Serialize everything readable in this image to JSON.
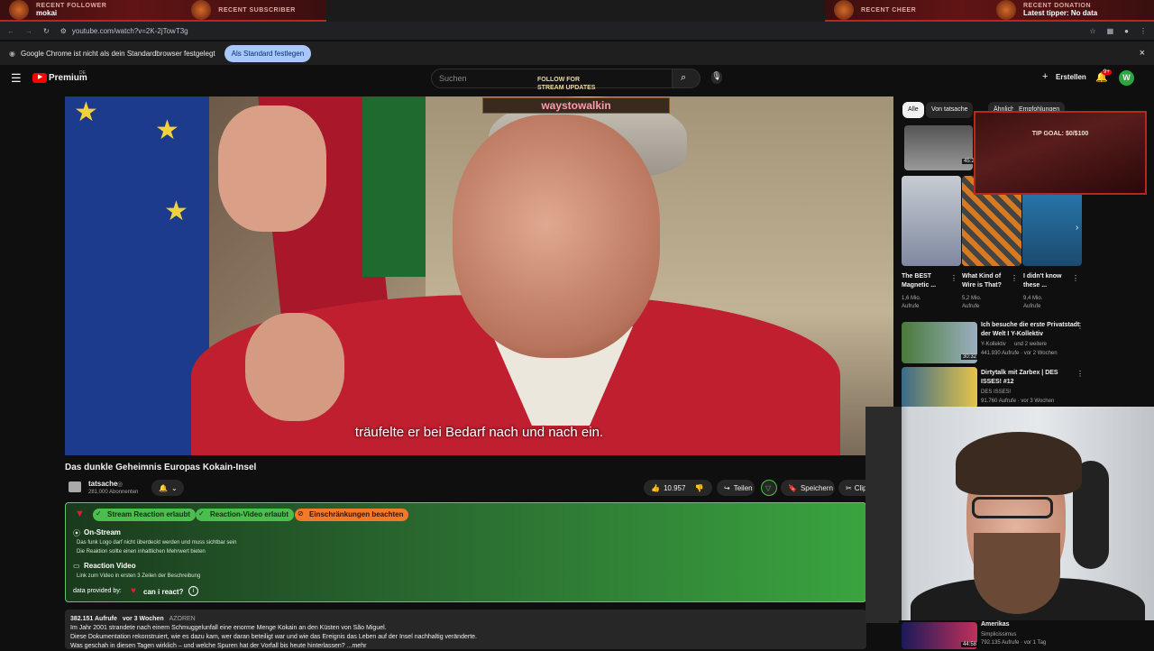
{
  "overlay": {
    "recent_follower_label": "RECENT FOLLOWER",
    "recent_follower_value": "mokai",
    "recent_subscriber_label": "RECENT SUBSCRIBER",
    "recent_subscriber_value": "",
    "recent_cheer_label": "RECENT CHEER",
    "recent_cheer_value": "",
    "recent_donation_label": "RECENT DONATION",
    "recent_donation_value": "Latest tipper: No data",
    "follow_text_1": "FOLLOW FOR",
    "follow_text_2": "STREAM UPDATES",
    "streamer_name": "waystowalkin",
    "tip_goal": "TIP GOAL: $0/$100"
  },
  "browser": {
    "url": "youtube.com/watch?v=2K-2jTowT3g",
    "notice": "Google Chrome ist nicht als dein Standardbrowser festgelegt",
    "set_default_button": "Als Standard festlegen",
    "close": "×"
  },
  "youtube": {
    "logo_text": "Premium",
    "logo_sup": "DE",
    "search_placeholder": "Suchen",
    "create_label": "Erstellen",
    "notif_count": "9+",
    "avatar_letter": "W"
  },
  "video": {
    "subtitle": "träufelte er bei Bedarf nach und nach ein.",
    "title": "Das dunkle Geheimnis Europas Kokain-Insel",
    "channel": "tatsache",
    "subscribers": "281.000 Abonnenten",
    "likes": "10.957",
    "share": "Teilen",
    "save": "Speichern",
    "clip": "Clip"
  },
  "reaction": {
    "badge_stream": "Stream Reaction erlaubt",
    "badge_video": "Reaction-Video erlaubt",
    "badge_restrict": "Einschränkungen beachten",
    "onstream_heading": "On-Stream",
    "onstream_1": "Das funk Logo darf nicht überdeckt werden und muss sichtbar sein",
    "onstream_2": "Die Reaktion sollte einen inhaltlichen Mehrwert bieten",
    "video_heading": "Reaction Video",
    "video_1": "Link zum Video in ersten 3 Zeilen der Beschreibung",
    "provided": "data provided by:",
    "provider": "can i react?"
  },
  "description": {
    "views": "382.151 Aufrufe",
    "ago": "vor 3 Wochen",
    "tag": "AZOREN",
    "line1": "Im Jahr 2001 strandete nach einem Schmuggelunfall eine enorme Menge Kokain an den Küsten von São Miguel.",
    "line2": "Diese Dokumentation rekonstruiert, wie es dazu kam, wer daran beteiligt war und wie das Ereignis das Leben auf der Insel nachhaltig veränderte.",
    "line3": "Was geschah in diesen Tagen wirklich – und welche Spuren hat der Vorfall bis heute hinterlassen? ...mehr"
  },
  "sidebar": {
    "chips": [
      "Alle",
      "Von tatsache",
      "Ähnlich",
      "Empfohlungen"
    ],
    "shorts": [
      {
        "title": "The BEST Magnetic ...",
        "views": "1,6 Mio.",
        "unit": "Aufrufe"
      },
      {
        "title": "What Kind of Wire is That?",
        "views": "5,2 Mio.",
        "unit": "Aufrufe"
      },
      {
        "title": "I didn't know these ...",
        "views": "9,4 Mio.",
        "unit": "Aufrufe"
      }
    ],
    "short_duration": "45:2",
    "videos": [
      {
        "title": "Ich besuche die erste Privatstadt der Welt I Y-Kollektiv",
        "channel": "Y-Kollektiv",
        "extra": "und 2 weitere",
        "meta": "441.930 Aufrufe · vor 2 Wochen",
        "duration": "30:32"
      },
      {
        "title": "Dirtytalk mit Zarbex | DES ISSES! #12",
        "channel": "DES ISSES!",
        "extra": "",
        "meta": "91.760 Aufrufe · vor 3 Wochen",
        "duration": "1:21:10"
      },
      {
        "title": "Amerikas",
        "channel": "Simplicissimus",
        "extra": "",
        "meta": "792.135 Aufrufe · vor 1 Tag",
        "duration": "44:58"
      }
    ]
  }
}
